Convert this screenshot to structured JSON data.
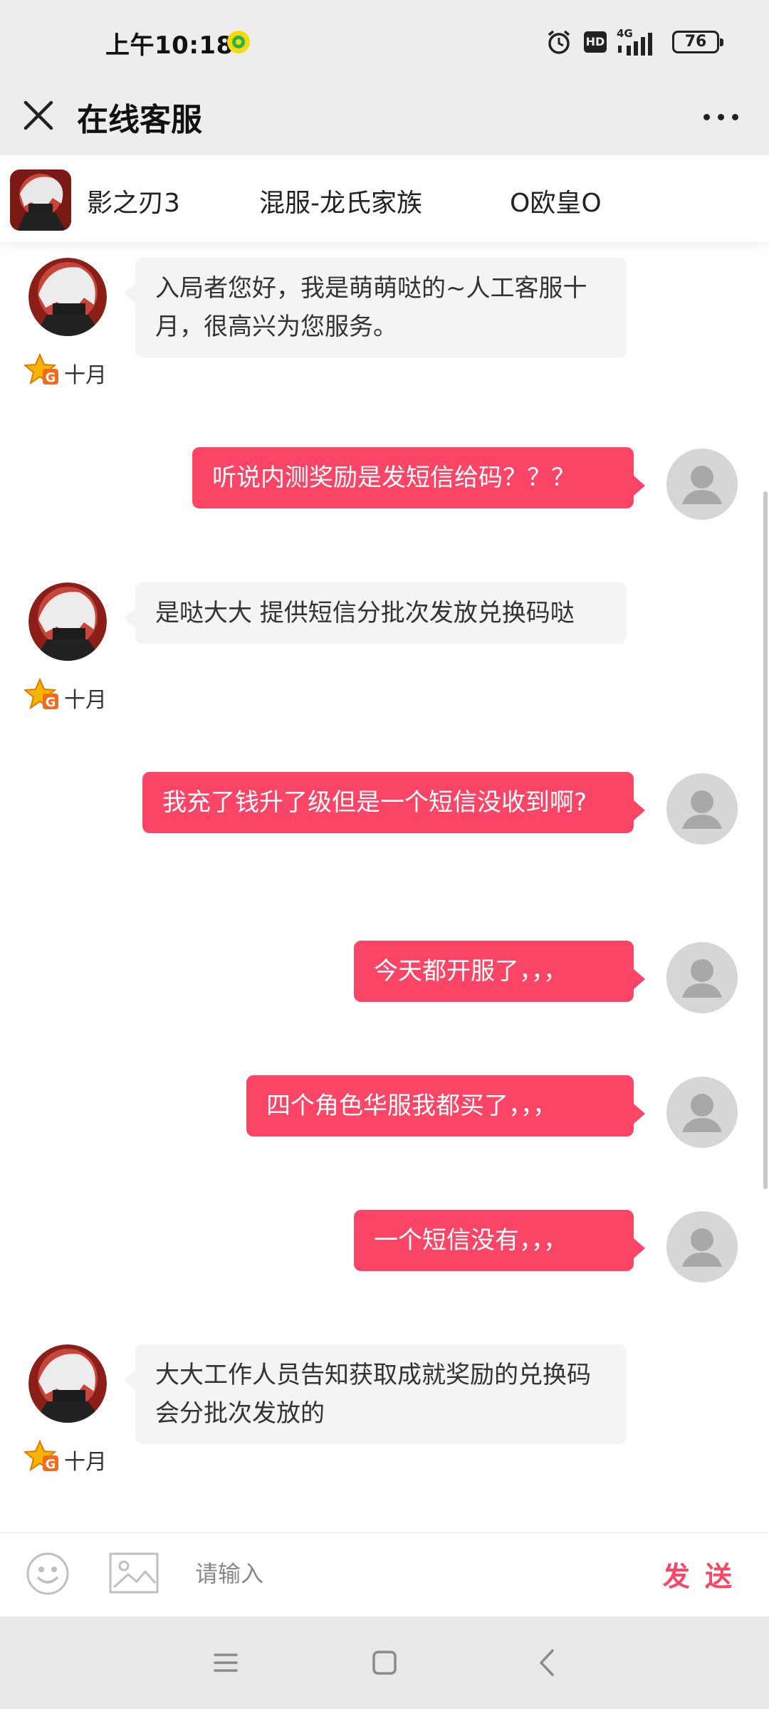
{
  "status_bar": {
    "time": "上午10:18",
    "network": "4G",
    "hd": "HD",
    "battery": "76"
  },
  "header": {
    "title": "在线客服"
  },
  "game_info": {
    "game": "影之刃3",
    "server": "混服-龙氏家族",
    "role": "O欧皇O"
  },
  "messages": [
    {
      "from": "agent",
      "name": "十月",
      "text": "入局者您好，我是萌萌哒的~人工客服十月，很高兴为您服务。"
    },
    {
      "from": "user",
      "text": "听说内测奖励是发短信给码？？？"
    },
    {
      "from": "agent",
      "name": "十月",
      "text": "是哒大大 提供短信分批次发放兑换码哒"
    },
    {
      "from": "user",
      "text": "我充了钱升了级但是一个短信没收到啊?"
    },
    {
      "from": "user",
      "text": "今天都开服了，，，"
    },
    {
      "from": "user",
      "text": "四个角色华服我都买了，，，"
    },
    {
      "from": "user",
      "text": "一个短信没有，，，"
    },
    {
      "from": "agent",
      "name": "十月",
      "text": "大大工作人员告知获取成就奖励的兑换码会分批次发放的"
    }
  ],
  "composer": {
    "placeholder": "请输入",
    "send_label": "发 送"
  },
  "colors": {
    "accent": "#fa4566",
    "incoming_bubble": "#f4f4f4",
    "header_bg": "#ededed"
  },
  "icons": {
    "close": "close-icon",
    "more": "more-icon",
    "emoji": "emoji-icon",
    "image": "image-icon",
    "badge": "vip-badge-icon",
    "nav_menu": "menu-icon",
    "nav_home": "home-icon",
    "nav_back": "back-icon"
  }
}
